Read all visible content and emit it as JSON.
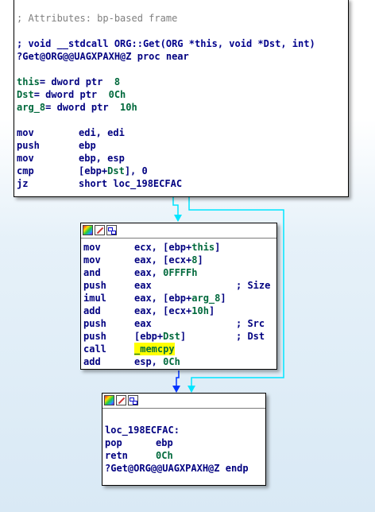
{
  "node_top": {
    "comment": "; Attributes: bp-based frame",
    "proto": "; void __stdcall ORG::Get(ORG *this, void *Dst, int)",
    "proc_name": "?Get@ORG@@UAGXPAXH@Z",
    "proc_kw": "proc near",
    "vars": [
      {
        "name": "this",
        "eq": "= dword ptr  ",
        "off": "8"
      },
      {
        "name": "Dst",
        "eq": "= dword ptr  ",
        "off": "0Ch"
      },
      {
        "name": "arg_8",
        "eq": "= dword ptr  ",
        "off": "10h"
      }
    ],
    "instrs": [
      {
        "op": "mov",
        "args": "edi, edi"
      },
      {
        "op": "push",
        "args": "ebp"
      },
      {
        "op": "mov",
        "args": "ebp, esp"
      },
      {
        "op": "cmp",
        "args_a": "[ebp+",
        "args_b": "Dst",
        "args_c": "], 0"
      },
      {
        "op": "jz",
        "args": "short loc_198ECFAC"
      }
    ]
  },
  "node_mid": {
    "l1": {
      "op": "mov",
      "a": "ecx, [ebp+",
      "b": "this",
      "c": "]"
    },
    "l2": {
      "op": "mov",
      "a": "eax, [ecx+",
      "b": "8",
      "c": "]"
    },
    "l3": {
      "op": "and",
      "a": "eax, ",
      "b": "0FFFFh"
    },
    "l4": {
      "op": "push",
      "a": "eax",
      "cmt": "; Size"
    },
    "l5": {
      "op": "imul",
      "a": "eax, [ebp+",
      "b": "arg_8",
      "c": "]"
    },
    "l6": {
      "op": "add",
      "a": "eax, [ecx+",
      "b": "10h",
      "c": "]"
    },
    "l7": {
      "op": "push",
      "a": "eax",
      "cmt": "; Src"
    },
    "l8": {
      "op": "push",
      "a": "[ebp+",
      "b": "Dst",
      "c": "]",
      "cmt": "; Dst"
    },
    "l9": {
      "op": "call",
      "fn": "_memcpy"
    },
    "l10": {
      "op": "add",
      "a": "esp, ",
      "b": "0Ch"
    }
  },
  "node_bot": {
    "label": "loc_198ECFAC:",
    "l1": {
      "op": "pop",
      "a": "ebp"
    },
    "l2": {
      "op": "retn",
      "b": "0Ch"
    },
    "endp_name": "?Get@ORG@@UAGXPAXH@Z",
    "endp_kw": "endp"
  },
  "colors": {
    "edge_cyan": "#00e5ff",
    "edge_blue": "#0033ff",
    "highlight": "#ffff00"
  },
  "icons": [
    "color-palette-icon",
    "edit-pencil-icon",
    "graph-overview-icon"
  ]
}
